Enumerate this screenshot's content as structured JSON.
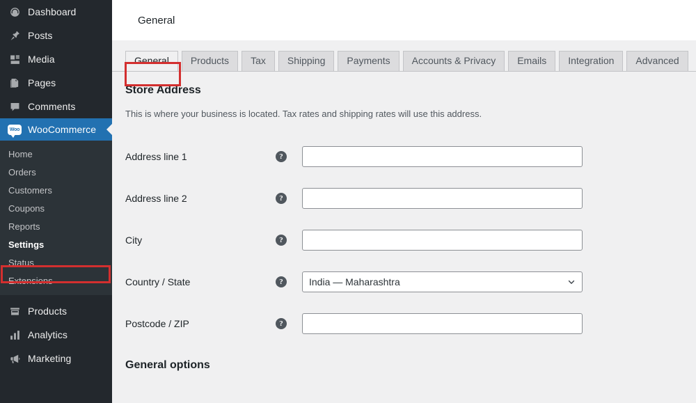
{
  "sidebar": {
    "top_items": [
      {
        "label": "Dashboard",
        "icon": "dashboard-icon"
      },
      {
        "label": "Posts",
        "icon": "pin-icon"
      },
      {
        "label": "Media",
        "icon": "media-icon"
      },
      {
        "label": "Pages",
        "icon": "pages-icon"
      },
      {
        "label": "Comments",
        "icon": "comments-icon"
      }
    ],
    "woocommerce": {
      "label": "WooCommerce",
      "icon": "woo-logo-icon",
      "logo_text": "Woo"
    },
    "submenu": [
      {
        "label": "Home"
      },
      {
        "label": "Orders"
      },
      {
        "label": "Customers"
      },
      {
        "label": "Coupons"
      },
      {
        "label": "Reports"
      },
      {
        "label": "Settings"
      },
      {
        "label": "Status"
      },
      {
        "label": "Extensions"
      }
    ],
    "bottom_items": [
      {
        "label": "Products",
        "icon": "products-icon"
      },
      {
        "label": "Analytics",
        "icon": "analytics-icon"
      },
      {
        "label": "Marketing",
        "icon": "marketing-icon"
      }
    ],
    "active_item": "WooCommerce",
    "current_subitem": "Settings",
    "highlight_color": "#d32f2f",
    "active_color": "#2271b1",
    "background": "#23282d",
    "submenu_background": "#2c3338"
  },
  "header": {
    "title": "General"
  },
  "tabs": [
    {
      "label": "General",
      "active": true
    },
    {
      "label": "Products",
      "active": false
    },
    {
      "label": "Tax",
      "active": false
    },
    {
      "label": "Shipping",
      "active": false
    },
    {
      "label": "Payments",
      "active": false
    },
    {
      "label": "Accounts & Privacy",
      "active": false
    },
    {
      "label": "Emails",
      "active": false
    },
    {
      "label": "Integration",
      "active": false
    },
    {
      "label": "Advanced",
      "active": false
    }
  ],
  "store_address": {
    "title": "Store Address",
    "description": "This is where your business is located. Tax rates and shipping rates will use this address.",
    "fields": [
      {
        "label": "Address line 1",
        "value": "",
        "type": "text",
        "help": "?"
      },
      {
        "label": "Address line 2",
        "value": "",
        "type": "text",
        "help": "?"
      },
      {
        "label": "City",
        "value": "",
        "type": "text",
        "help": "?"
      },
      {
        "label": "Country / State",
        "value": "India — Maharashtra",
        "type": "select",
        "help": "?"
      },
      {
        "label": "Postcode / ZIP",
        "value": "",
        "type": "text",
        "help": "?"
      }
    ]
  },
  "general_options": {
    "title": "General options"
  }
}
